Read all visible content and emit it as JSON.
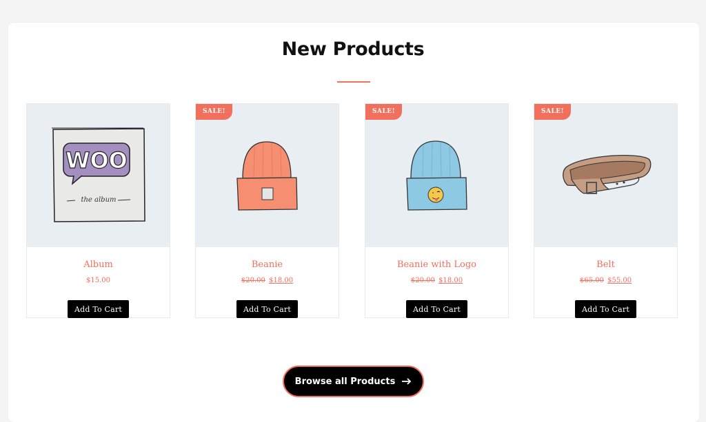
{
  "section": {
    "title": "New Products",
    "accent_color": "#f16f5d"
  },
  "products": [
    {
      "name": "Album",
      "sale_badge": "",
      "price_old": "",
      "price_now": "$15.00",
      "button_label": "Add To Cart",
      "image_icon": "woo-album-icon",
      "image_text": "WOO",
      "image_subtext": "the album"
    },
    {
      "name": "Beanie",
      "sale_badge": "SALE!",
      "price_old": "$20.00",
      "price_now": "$18.00",
      "button_label": "Add To Cart",
      "image_icon": "beanie-orange-icon"
    },
    {
      "name": "Beanie with Logo",
      "sale_badge": "SALE!",
      "price_old": "$20.00",
      "price_now": "$18.00",
      "button_label": "Add To Cart",
      "image_icon": "beanie-blue-logo-icon"
    },
    {
      "name": "Belt",
      "sale_badge": "SALE!",
      "price_old": "$65.00",
      "price_now": "$55.00",
      "button_label": "Add To Cart",
      "image_icon": "belt-icon"
    }
  ],
  "browse": {
    "label": "Browse all Products",
    "icon": "arrow-right-icon"
  }
}
